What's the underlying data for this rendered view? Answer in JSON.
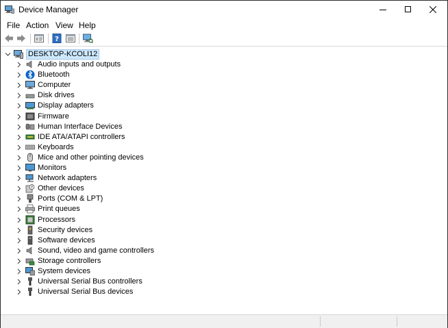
{
  "window": {
    "title": "Device Manager"
  },
  "menu": [
    "File",
    "Action",
    "View",
    "Help"
  ],
  "toolbar": [
    "back-icon",
    "forward-icon",
    "properties-icon",
    "help-icon",
    "view-icon",
    "scan-hardware-icon"
  ],
  "tree": {
    "root": "DESKTOP-KCOLI12",
    "items": [
      {
        "label": "Audio inputs and outputs",
        "icon": "speaker-icon"
      },
      {
        "label": "Bluetooth",
        "icon": "bluetooth-icon"
      },
      {
        "label": "Computer",
        "icon": "computer-icon"
      },
      {
        "label": "Disk drives",
        "icon": "disk-drive-icon"
      },
      {
        "label": "Display adapters",
        "icon": "display-adapter-icon"
      },
      {
        "label": "Firmware",
        "icon": "firmware-icon"
      },
      {
        "label": "Human Interface Devices",
        "icon": "hid-icon"
      },
      {
        "label": "IDE ATA/ATAPI controllers",
        "icon": "ide-controller-icon"
      },
      {
        "label": "Keyboards",
        "icon": "keyboard-icon"
      },
      {
        "label": "Mice and other pointing devices",
        "icon": "mouse-icon"
      },
      {
        "label": "Monitors",
        "icon": "monitor-icon"
      },
      {
        "label": "Network adapters",
        "icon": "network-adapter-icon"
      },
      {
        "label": "Other devices",
        "icon": "unknown-device-icon"
      },
      {
        "label": "Ports (COM & LPT)",
        "icon": "port-icon"
      },
      {
        "label": "Print queues",
        "icon": "printer-icon"
      },
      {
        "label": "Processors",
        "icon": "processor-icon"
      },
      {
        "label": "Security devices",
        "icon": "security-device-icon"
      },
      {
        "label": "Software devices",
        "icon": "software-device-icon"
      },
      {
        "label": "Sound, video and game controllers",
        "icon": "sound-controller-icon"
      },
      {
        "label": "Storage controllers",
        "icon": "storage-controller-icon"
      },
      {
        "label": "System devices",
        "icon": "system-devices-icon"
      },
      {
        "label": "Universal Serial Bus controllers",
        "icon": "usb-controller-icon"
      },
      {
        "label": "Universal Serial Bus devices",
        "icon": "usb-device-icon"
      }
    ]
  },
  "colors": {
    "selection": "#cce8ff",
    "accent": "#0078d7"
  }
}
